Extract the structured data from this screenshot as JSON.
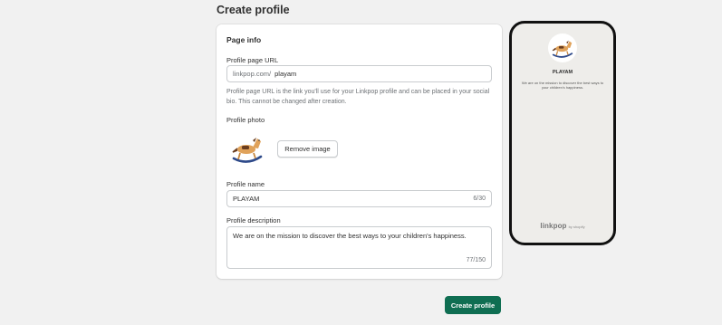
{
  "page": {
    "title": "Create profile"
  },
  "card": {
    "section_title": "Page info",
    "url": {
      "label": "Profile page URL",
      "prefix": "linkpop.com/",
      "value": "playam",
      "help": "Profile page URL is the link you'll use for your Linkpop profile and can be placed in your social bio. This cannot be changed after creation."
    },
    "photo": {
      "label": "Profile photo",
      "remove_label": "Remove image"
    },
    "name": {
      "label": "Profile name",
      "value": "PLAYAM",
      "count": "6/30"
    },
    "description": {
      "label": "Profile description",
      "value": "We are on the mission to discover the best ways to your children's happiness.",
      "count": "77/150"
    }
  },
  "actions": {
    "create_label": "Create profile"
  },
  "preview": {
    "name": "PLAYAM",
    "description": "We are on the mission to discover the best ways to your children's happiness.",
    "brand": "linkpop",
    "brand_suffix": "by shopify"
  },
  "colors": {
    "primary": "#0f6e52",
    "background": "#f1f1f1",
    "phone_screen": "#eeedea"
  },
  "icons": {
    "avatar": "rocking-horse-image"
  }
}
